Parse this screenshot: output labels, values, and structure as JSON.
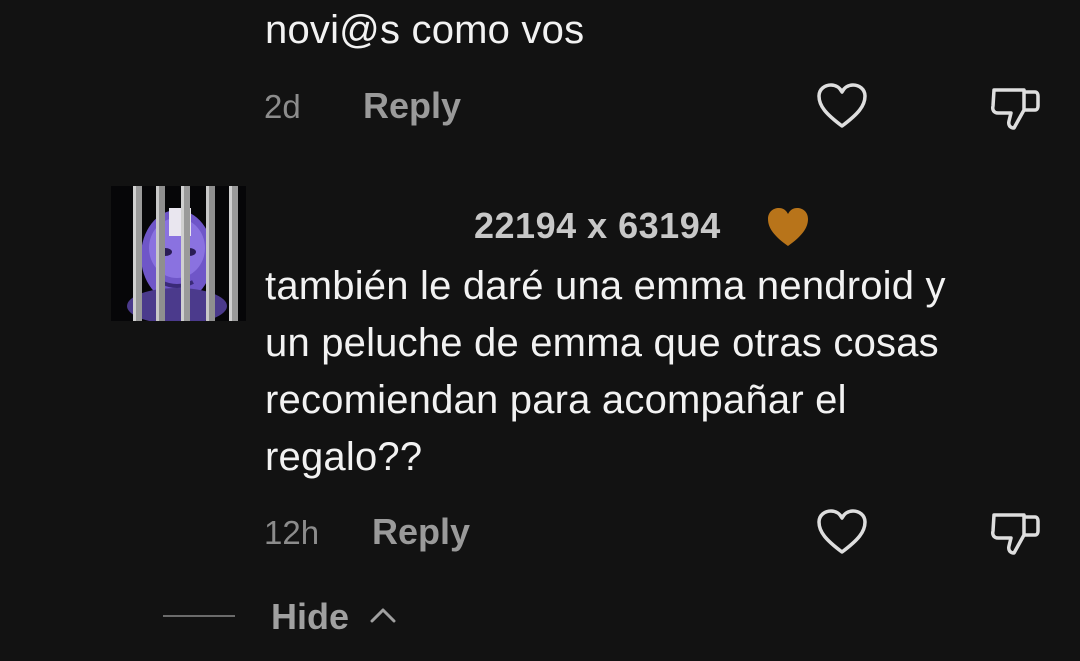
{
  "comment1": {
    "text": "novi@s como vos",
    "time": "2d",
    "reply_label": "Reply"
  },
  "comment2": {
    "username": "22194 x 63194",
    "lines": [
      "también le daré una emma nendroid y",
      "un peluche de emma que otras cosas",
      "recomiendan para acompañar el",
      "regalo??"
    ],
    "time": "12h",
    "reply_label": "Reply"
  },
  "replies_toggle": {
    "label": "Hide"
  },
  "colors": {
    "background": "#121212",
    "heart_emoji": "#b8741a",
    "avatar_purple": "#7b5bd6"
  },
  "icons": [
    "like-heart-icon",
    "dislike-thumb-icon",
    "brown-heart-emoji-icon",
    "chevron-up-icon"
  ]
}
